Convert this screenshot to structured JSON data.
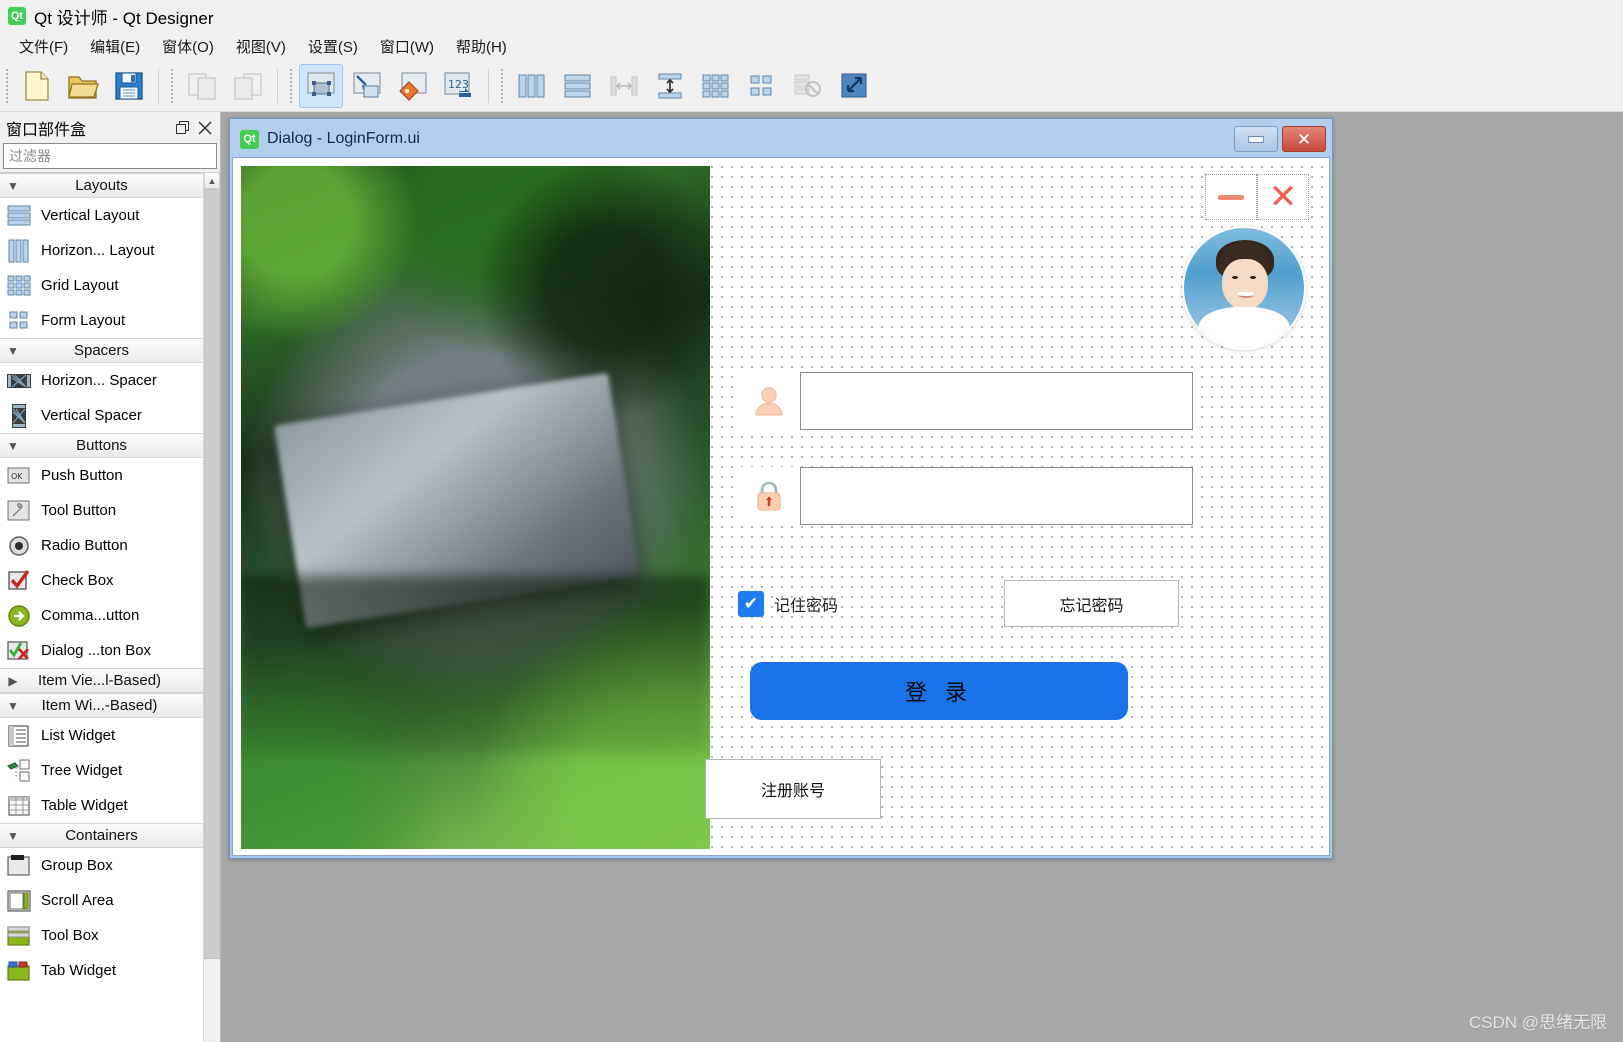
{
  "app": {
    "title": "Qt 设计师 - Qt Designer",
    "logo_text": "Qt"
  },
  "menubar": {
    "items": [
      {
        "label": "文件(F)",
        "name": "menu-file"
      },
      {
        "label": "编辑(E)",
        "name": "menu-edit"
      },
      {
        "label": "窗体(O)",
        "name": "menu-form"
      },
      {
        "label": "视图(V)",
        "name": "menu-view"
      },
      {
        "label": "设置(S)",
        "name": "menu-settings"
      },
      {
        "label": "窗口(W)",
        "name": "menu-window"
      },
      {
        "label": "帮助(H)",
        "name": "menu-help"
      }
    ]
  },
  "toolbar": {
    "groups": [
      {
        "buttons": [
          {
            "name": "new-form-icon",
            "state": "enabled"
          },
          {
            "name": "open-form-icon",
            "state": "enabled"
          },
          {
            "name": "save-form-icon",
            "state": "enabled"
          }
        ]
      },
      {
        "buttons": [
          {
            "name": "undo-icon",
            "state": "disabled"
          },
          {
            "name": "redo-icon",
            "state": "disabled"
          }
        ]
      },
      {
        "buttons": [
          {
            "name": "edit-widgets-icon",
            "state": "active"
          },
          {
            "name": "edit-signals-slots-icon",
            "state": "enabled"
          },
          {
            "name": "edit-buddies-icon",
            "state": "enabled"
          },
          {
            "name": "edit-tab-order-icon",
            "state": "enabled"
          }
        ]
      },
      {
        "buttons": [
          {
            "name": "layout-horizontally-icon",
            "state": "enabled"
          },
          {
            "name": "layout-vertically-icon",
            "state": "enabled"
          },
          {
            "name": "layout-horizontal-splitter-icon",
            "state": "disabled"
          },
          {
            "name": "layout-vertical-splitter-icon",
            "state": "enabled"
          },
          {
            "name": "layout-grid-icon",
            "state": "enabled"
          },
          {
            "name": "layout-form-icon",
            "state": "enabled"
          },
          {
            "name": "break-layout-icon",
            "state": "disabled"
          },
          {
            "name": "adjust-size-icon",
            "state": "enabled"
          }
        ]
      }
    ]
  },
  "widget_box": {
    "title": "窗口部件盒",
    "float_button": "float-icon",
    "close_button": "close-icon",
    "filter_placeholder": "过滤器",
    "filter_value": "",
    "scroll_up_label": "^",
    "groups": [
      {
        "label": "Layouts",
        "expanded": true,
        "items": [
          {
            "label": "Vertical Layout",
            "icon": "vertical-layout-icon"
          },
          {
            "label": "Horizon... Layout",
            "icon": "horizontal-layout-icon"
          },
          {
            "label": "Grid Layout",
            "icon": "grid-layout-icon"
          },
          {
            "label": "Form Layout",
            "icon": "form-layout-icon"
          }
        ]
      },
      {
        "label": "Spacers",
        "expanded": true,
        "items": [
          {
            "label": "Horizon... Spacer",
            "icon": "horizontal-spacer-icon"
          },
          {
            "label": "Vertical Spacer",
            "icon": "vertical-spacer-icon"
          }
        ]
      },
      {
        "label": "Buttons",
        "expanded": true,
        "items": [
          {
            "label": "Push Button",
            "icon": "push-button-icon"
          },
          {
            "label": "Tool Button",
            "icon": "tool-button-icon"
          },
          {
            "label": "Radio Button",
            "icon": "radio-button-icon"
          },
          {
            "label": "Check Box",
            "icon": "check-box-icon"
          },
          {
            "label": "Comma...utton",
            "icon": "command-link-button-icon"
          },
          {
            "label": "Dialog ...ton Box",
            "icon": "dialog-button-box-icon"
          }
        ]
      },
      {
        "label": "Item Vie...l-Based)",
        "expanded": false,
        "items": []
      },
      {
        "label": "Item Wi...-Based)",
        "expanded": true,
        "items": [
          {
            "label": "List Widget",
            "icon": "list-widget-icon"
          },
          {
            "label": "Tree Widget",
            "icon": "tree-widget-icon"
          },
          {
            "label": "Table Widget",
            "icon": "table-widget-icon"
          }
        ]
      },
      {
        "label": "Containers",
        "expanded": true,
        "items": [
          {
            "label": "Group Box",
            "icon": "group-box-icon"
          },
          {
            "label": "Scroll Area",
            "icon": "scroll-area-icon"
          },
          {
            "label": "Tool Box",
            "icon": "tool-box-icon"
          },
          {
            "label": "Tab Widget",
            "icon": "tab-widget-icon"
          }
        ]
      }
    ]
  },
  "form_window": {
    "logo_text": "Qt",
    "title": "Dialog - LoginForm.ui",
    "minimize_label": "minimize-icon",
    "close_label": "✕"
  },
  "login_form": {
    "window_minimize": "minimize-icon",
    "window_close": "✕",
    "avatar": "user-avatar-photo",
    "background_photo": "circuit-board-photo",
    "username": {
      "value": "",
      "placeholder": "",
      "icon": "user-icon"
    },
    "password": {
      "value": "",
      "placeholder": "",
      "icon": "lock-icon"
    },
    "remember": {
      "label": "记住密码",
      "checked": true,
      "check_glyph": "✔"
    },
    "forgot_label": "忘记密码",
    "login_label": "登 录",
    "register_label": "注册账号",
    "accent_color": "#1a73e8"
  },
  "watermark": "CSDN @思绪无限"
}
